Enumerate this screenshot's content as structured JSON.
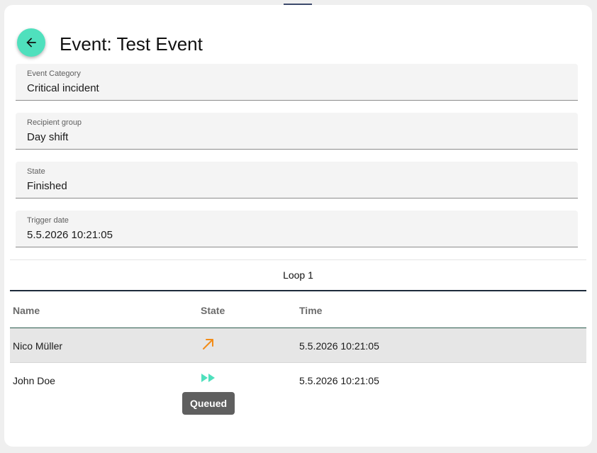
{
  "header": {
    "title": "Event: Test Event",
    "back_icon": "arrow-left-icon",
    "collapse_icon": "chevron-down-icon"
  },
  "fields": [
    {
      "label": "Event Category",
      "value": "Critical incident"
    },
    {
      "label": "Recipient group",
      "value": "Day shift"
    },
    {
      "label": "State",
      "value": "Finished"
    },
    {
      "label": "Trigger date",
      "value": "5.5.2026 10:21:05"
    }
  ],
  "tabs": [
    {
      "label": "Loop 1"
    }
  ],
  "table": {
    "columns": [
      "Name",
      "State",
      "Time"
    ],
    "rows": [
      {
        "name": "Nico Müller",
        "state_icon": "arrow-up-right-icon",
        "time": "5.5.2026 10:21:05"
      },
      {
        "name": "John Doe",
        "state_icon": "fast-forward-icon",
        "time": "5.5.2026 10:21:05"
      }
    ]
  },
  "tooltip": {
    "text": "Queued"
  },
  "colors": {
    "accent": "#4fe0bd",
    "sent_state": "#f28c18",
    "queued_state": "#4fe0bd",
    "tab_indicator": "#1d2b3a",
    "handle": "#3d4a6b"
  }
}
